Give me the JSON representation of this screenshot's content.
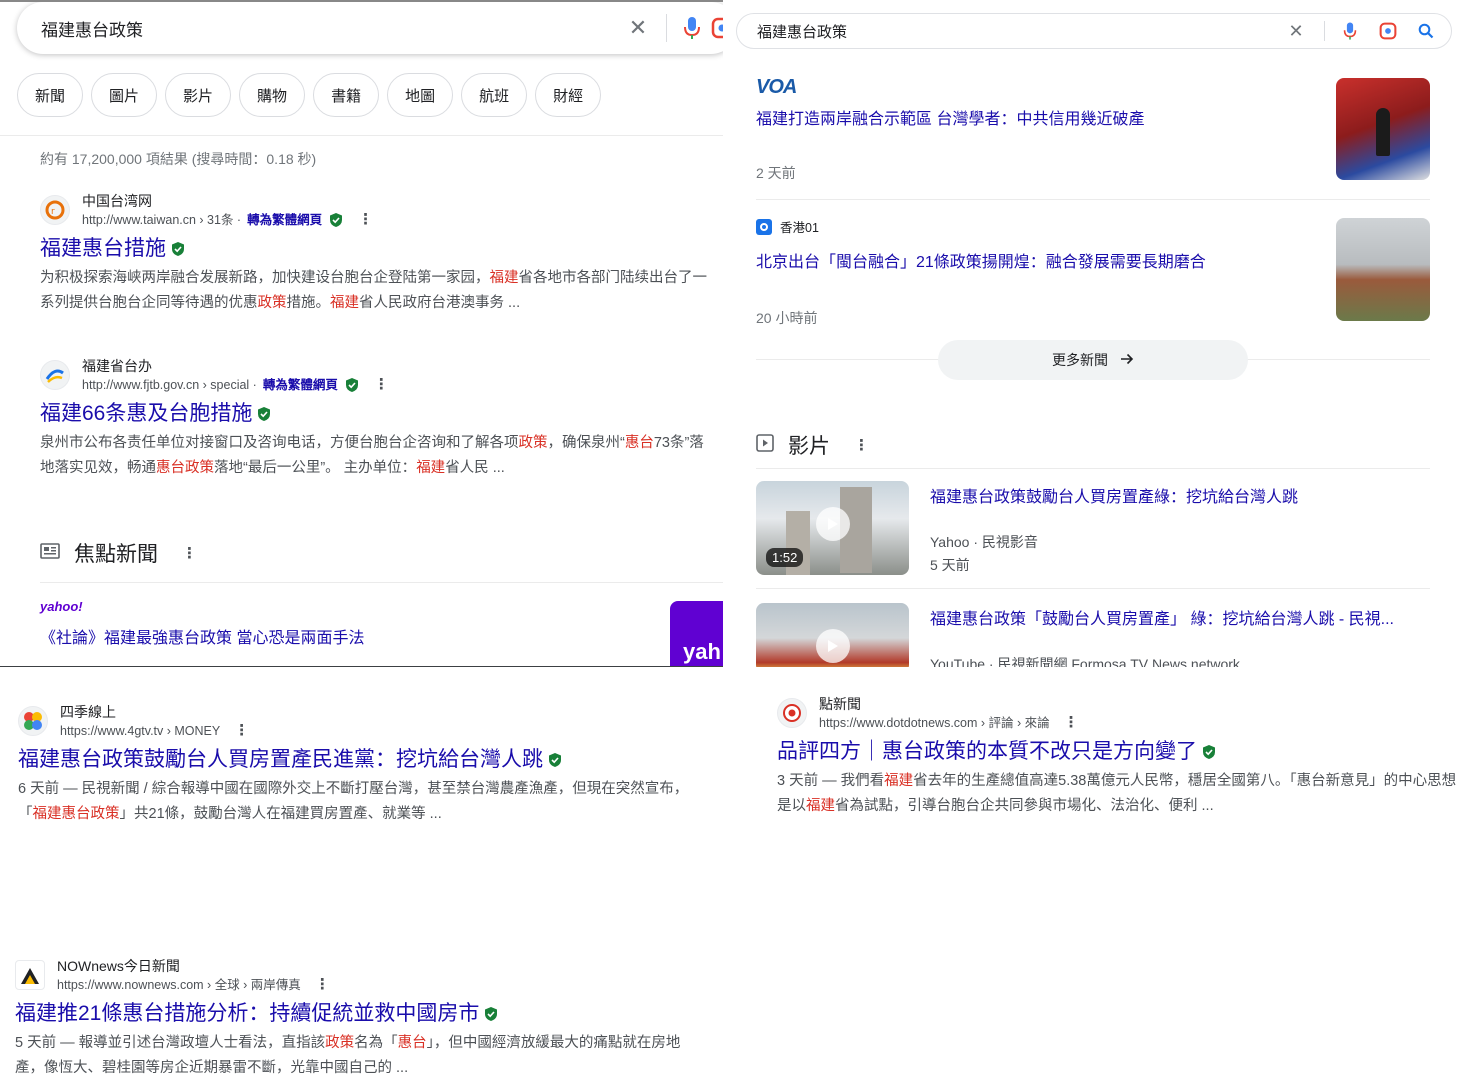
{
  "search": {
    "query": "福建惠台政策"
  },
  "chips": [
    "新聞",
    "圖片",
    "影片",
    "購物",
    "書籍",
    "地圖",
    "航班",
    "財經"
  ],
  "stats": "約有 17,200,000 項結果 (搜尋時間：0.18 秒)",
  "translate_label": "轉為繁體網頁",
  "results": [
    {
      "site": "中国台湾网",
      "url": "http://www.taiwan.cn › 31条 ·",
      "title": "福建惠台措施",
      "snippet": [
        {
          "t": "为积极探索海峡两岸融合发展新路，加快建设台胞台企登陆第一家园，"
        },
        {
          "t": "福建",
          "hl": true
        },
        {
          "t": "省各地市各部门陆续出台了一系列提供台胞台企同等待遇的优惠"
        },
        {
          "t": "政策",
          "hl": true
        },
        {
          "t": "措施。"
        },
        {
          "t": "福建",
          "hl": true
        },
        {
          "t": "省人民政府台港澳事务 ..."
        }
      ]
    },
    {
      "site": "福建省台办",
      "url": "http://www.fjtb.gov.cn › special ·",
      "title": "福建66条惠及台胞措施",
      "snippet": [
        {
          "t": "泉州市公布各责任单位对接窗口及咨询电话，方便台胞台企咨询和了解各项"
        },
        {
          "t": "政策",
          "hl": true
        },
        {
          "t": "，确保泉州“"
        },
        {
          "t": "惠台",
          "hl": true
        },
        {
          "t": "73条”落地落实见效，畅通"
        },
        {
          "t": "惠台政策",
          "hl": true
        },
        {
          "t": "落地“最后一公里”。 主办单位："
        },
        {
          "t": "福建",
          "hl": true
        },
        {
          "t": "省人民 ..."
        }
      ]
    }
  ],
  "top_news": {
    "heading": "焦點新聞",
    "items": [
      {
        "source": "yahoo!",
        "title": "《社論》福建最強惠台政策 當心恐是兩面手法",
        "thumb_text": "yah"
      },
      {
        "source": "VOA",
        "title": "福建打造兩岸融合示範區 台灣學者：中共信用幾近破產",
        "age": "2 天前"
      },
      {
        "source": "香港01",
        "title": "北京出台「閩台融合」21條政策揚開煌：融合發展需要長期磨合",
        "age": "20 小時前"
      }
    ],
    "more_label": "更多新聞"
  },
  "videos": {
    "heading": "影片",
    "items": [
      {
        "title": "福建惠台政策鼓勵台人買房置產綠：挖坑給台灣人跳",
        "source": "Yahoo",
        "channel": "民視影音",
        "age": "5 天前",
        "duration": "1:52"
      },
      {
        "title": "福建惠台政策「鼓勵台人買房置產」 綠：挖坑給台灣人跳 - 民視...",
        "source": "YouTube",
        "channel": "民視新聞網 Formosa TV News network"
      }
    ]
  },
  "bottom_results": [
    {
      "site": "四季線上",
      "url": "https://www.4gtv.tv › MONEY",
      "title": "福建惠台政策鼓勵台人買房置產民進黨：挖坑給台灣人跳",
      "snippet": [
        {
          "t": "6 天前 — 民視新聞 / 綜合報導中國在國際外交上不斷打壓台灣，甚至禁台灣農產漁產，但現在突然宣布，「"
        },
        {
          "t": "福建惠台政策",
          "hl": true
        },
        {
          "t": "」共21條，鼓勵台灣人在福建買房置產、就業等 ..."
        }
      ]
    },
    {
      "site": "NOWnews今日新聞",
      "url": "https://www.nownews.com › 全球 › 兩岸傳真",
      "title": "福建推21條惠台措施分析：持續促統並救中國房市",
      "snippet": [
        {
          "t": "5 天前 — 報導並引述台灣政壇人士看法，直指該"
        },
        {
          "t": "政策",
          "hl": true
        },
        {
          "t": "名為「"
        },
        {
          "t": "惠台",
          "hl": true
        },
        {
          "t": "」，但中國經濟放緩最大的痛點就在房地產，像恆大、碧桂園等房企近期暴雷不斷，光靠中國自己的 ..."
        }
      ]
    },
    {
      "site": "點新聞",
      "url": "https://www.dotdotnews.com › 評論 › 來論",
      "title": "品評四方｜惠台政策的本質不改只是方向變了",
      "snippet": [
        {
          "t": "3 天前 — 我們看"
        },
        {
          "t": "福建",
          "hl": true
        },
        {
          "t": "省去年的生產總值高達5.38萬億元人民幣，穩居全國第八。「惠台新意見」的中心思想是以"
        },
        {
          "t": "福建",
          "hl": true
        },
        {
          "t": "省為試點，引導台胞台企共同參與市場化、法治化、便利 ..."
        }
      ]
    }
  ],
  "colors": {
    "link": "#1a0dab",
    "highlight": "#d93025",
    "verified": "#188038"
  }
}
